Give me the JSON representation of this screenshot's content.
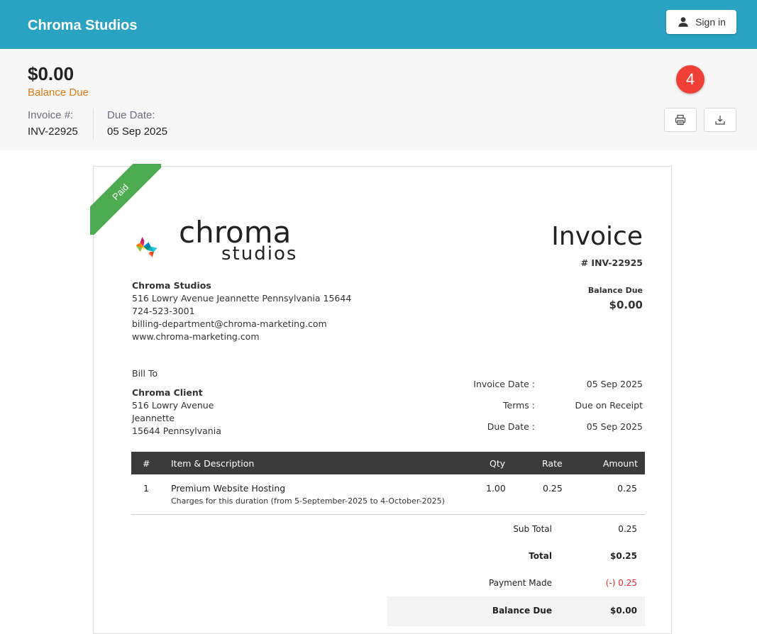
{
  "header": {
    "brand": "Chroma Studios",
    "signin_label": "Sign in"
  },
  "summary": {
    "balance_amount": "$0.00",
    "balance_label": "Balance Due",
    "invoice_no_label": "Invoice #:",
    "invoice_no": "INV-22925",
    "due_date_label": "Due Date:",
    "due_date": "05 Sep 2025",
    "badge_count": "4"
  },
  "invoice": {
    "ribbon": "Paid",
    "logo_text_1": "chroma",
    "logo_text_2": "studios",
    "org": {
      "name": "Chroma Studios",
      "address": "516 Lowry Avenue  Jeannette Pennsylvania 15644",
      "phone": "724-523-3001",
      "email": "billing-department@chroma-marketing.com",
      "website": "www.chroma-marketing.com"
    },
    "title": "Invoice",
    "number": "# INV-22925",
    "balance_due_label": "Balance Due",
    "balance_due": "$0.00",
    "bill_to_label": "Bill To",
    "client": {
      "name": "Chroma Client",
      "line1": "516 Lowry Avenue",
      "line2": "Jeannette",
      "line3": "15644 Pennsylvania"
    },
    "info": {
      "invoice_date_label": "Invoice Date :",
      "invoice_date": "05 Sep 2025",
      "terms_label": "Terms :",
      "terms": "Due on Receipt",
      "due_date_label": "Due Date :",
      "due_date": "05 Sep 2025"
    },
    "table": {
      "headers": {
        "num": "#",
        "item": "Item & Description",
        "qty": "Qty",
        "rate": "Rate",
        "amount": "Amount"
      },
      "rows": [
        {
          "num": "1",
          "item": "Premium Website Hosting",
          "desc": "Charges for this duration (from 5-September-2025 to 4-October-2025)",
          "qty": "1.00",
          "rate": "0.25",
          "amount": "0.25"
        }
      ]
    },
    "totals": {
      "subtotal_label": "Sub Total",
      "subtotal": "0.25",
      "total_label": "Total",
      "total": "$0.25",
      "payment_label": "Payment Made",
      "payment": "(-) 0.25",
      "balance_label": "Balance Due",
      "balance": "$0.00"
    }
  },
  "colors": {
    "topbar": "#2aa3c2",
    "balance_label": "#e07b12",
    "badge": "#f04036",
    "paid_ribbon": "#4caa4f",
    "table_header": "#3b3b3b",
    "payment_red": "#e5272d"
  }
}
